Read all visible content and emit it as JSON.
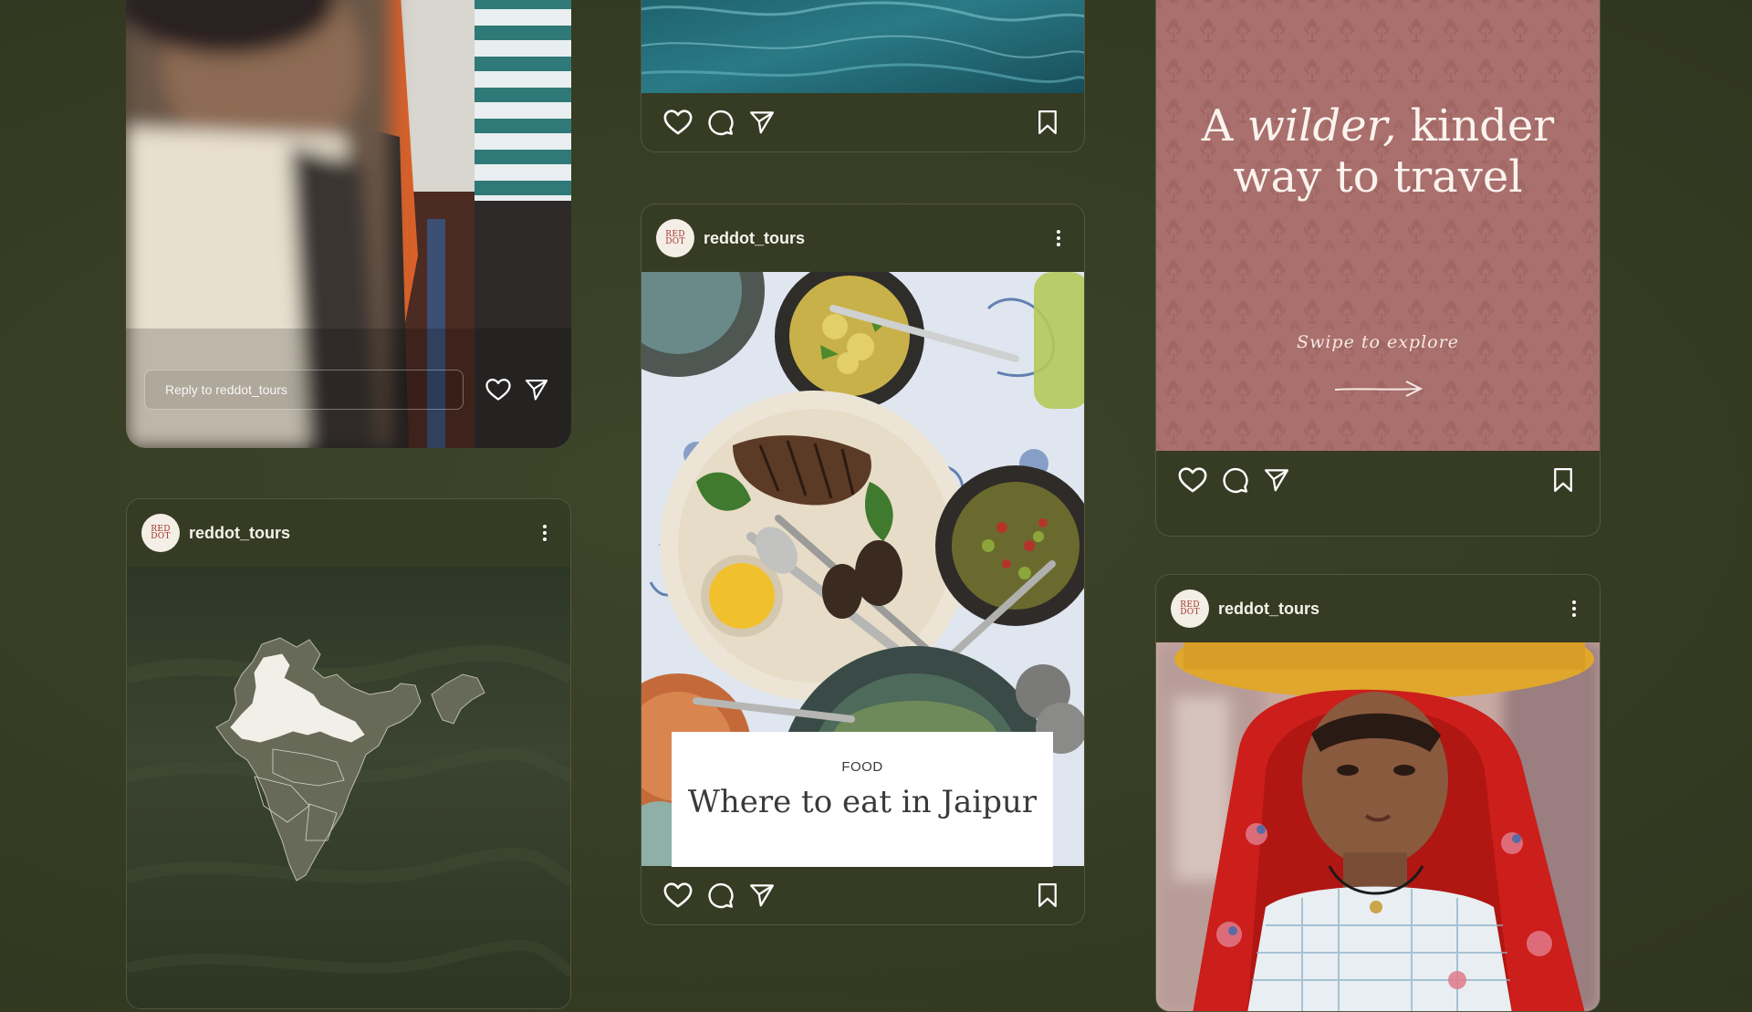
{
  "account": {
    "username": "reddot_tours",
    "avatar_text_top": "RED",
    "avatar_text_bottom": "DOT"
  },
  "story_card": {
    "reply_placeholder": "Reply to reddot_tours",
    "like_icon": "heart-icon",
    "send_icon": "send-icon"
  },
  "map_post": {
    "username": "reddot_tours",
    "image": "india-map-over-tea-hills",
    "highlight_color": "#f1efe8"
  },
  "water_post": {
    "image": "turquoise-water"
  },
  "food_post": {
    "username": "reddot_tours",
    "tag": "FOOD",
    "title": "Where to eat in Jaipur",
    "image": "table-of-indian-dishes"
  },
  "travel_post": {
    "headline_pre": "A ",
    "headline_em": "wilder,",
    "headline_post": " kinder",
    "headline_line2": "way to travel",
    "swipe_text": "Swipe to explore",
    "pattern_color": "#a9706d"
  },
  "portrait_post": {
    "username": "reddot_tours",
    "image": "woman-in-red-headscarf-carrying-basket"
  },
  "icons": {
    "like": "heart-icon",
    "comment": "comment-icon",
    "share": "send-icon",
    "save": "bookmark-icon",
    "more": "more-vertical-icon"
  },
  "colors": {
    "background": "#373d24",
    "card_border": "rgba(255,255,255,0.14)",
    "accent_red": "#a0352f"
  }
}
